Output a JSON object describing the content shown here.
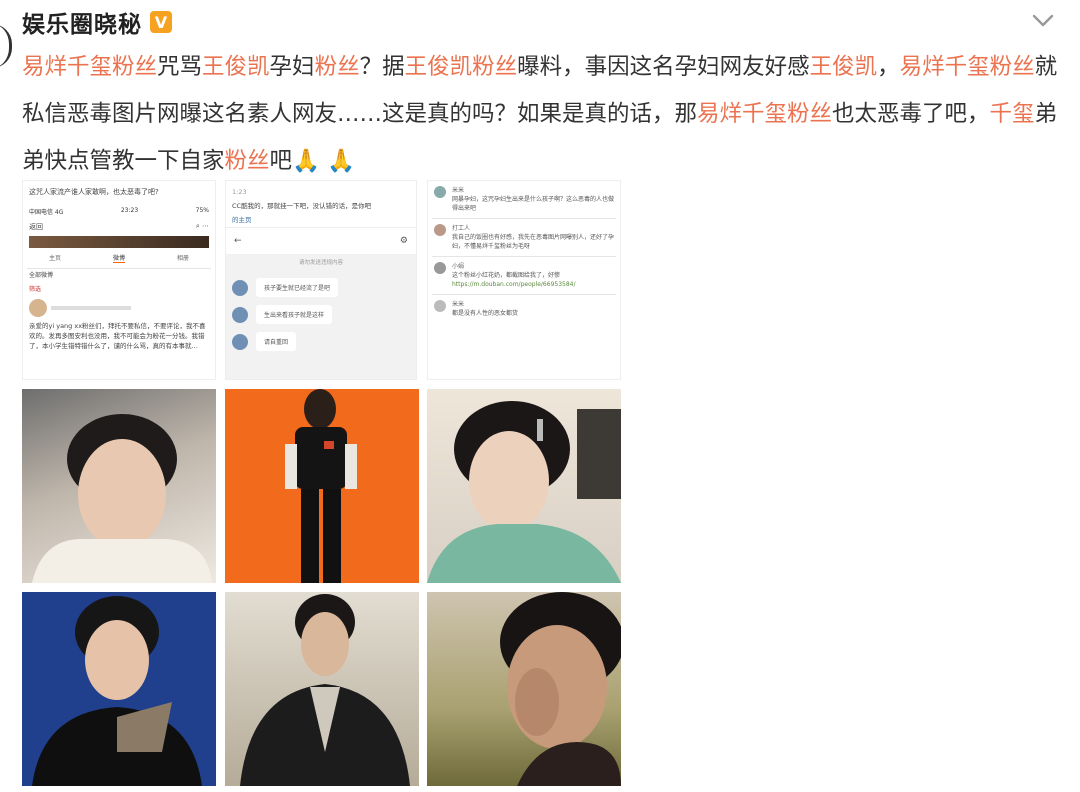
{
  "header": {
    "username": "娱乐圈晓秘",
    "verified_badge": "V",
    "chevron_icon": "chevron-down-icon"
  },
  "post": {
    "segments": [
      {
        "text": "易烊千玺粉丝",
        "hl": true
      },
      {
        "text": "咒骂",
        "hl": false
      },
      {
        "text": "王俊凯",
        "hl": true
      },
      {
        "text": "孕妇",
        "hl": false
      },
      {
        "text": "粉丝",
        "hl": true
      },
      {
        "text": "？据",
        "hl": false
      },
      {
        "text": "王俊凯粉丝",
        "hl": true
      },
      {
        "text": "曝料，事因这名孕妇网友好感",
        "hl": false
      },
      {
        "text": "王俊凯",
        "hl": true
      },
      {
        "text": "，",
        "hl": false
      },
      {
        "text": "易烊千玺粉丝",
        "hl": true
      },
      {
        "text": "就私信恶毒图片网曝这名素人网友……这是真的吗？如果是真的话，那",
        "hl": false
      },
      {
        "text": "易烊千玺粉丝",
        "hl": true
      },
      {
        "text": "也太恶毒了吧，",
        "hl": false
      },
      {
        "text": "千玺",
        "hl": true
      },
      {
        "text": "弟弟快点管教一下自家",
        "hl": false
      },
      {
        "text": "粉丝",
        "hl": true
      },
      {
        "text": "吧🙏 🙏",
        "hl": false
      }
    ],
    "highlight_color": "#eb7350"
  },
  "screenshots": {
    "shot1": {
      "caption": "这咒人家流产谁人家敢啊，也太恶毒了吧?",
      "status_left": "中国电信 4G",
      "status_time": "23:23",
      "status_right": "75%",
      "back": "返回",
      "tabs": [
        "主页",
        "微博",
        "相册"
      ],
      "section": "全部微博",
      "filter": "筛选",
      "body": "亲爱的yi yang xx粉丝们，拜托不要私信，不要评论，我不喜欢的。发再多图安利也没用，我不可能会为粉花一分钱。我错了，本小学生错特错什么了，谴的什么骂，真的有本事就…"
    },
    "shot2": {
      "top_text": "CC酷我的，那就挂一下吧，没认错的话，是你吧",
      "link": "的主页",
      "time": "1:23",
      "notice": "请勿发送违规内容",
      "messages": [
        "孩子要生就已经流了是吧",
        "生出来看孩子就是这样",
        "请自重回"
      ]
    },
    "shot3": {
      "comments": [
        {
          "name": "米米",
          "text": "网暴孕妇，这咒孕妇生出来是什么孩子啊？这么恶毒的人也做得出来吧"
        },
        {
          "name": "打工人",
          "text": "我自己的饭圈也有好感，我先在恶毒图片网曝别人，还好了孕妇，不懂易烊千玺粉丝为毛呀"
        },
        {
          "name": "小娟",
          "text": "这个粉丝小红花奶，都截图给我了，好惨",
          "link": "https://m.douban.com/people/66953584/"
        },
        {
          "name": "米米",
          "text": "都是没有人性的恶女都货"
        }
      ]
    }
  },
  "photos": [
    {
      "icon": "photo-portrait-white-sweater",
      "bg": "#d9cdc0"
    },
    {
      "icon": "photo-orange-backdrop-black-tee",
      "bg": "#f26a1b"
    },
    {
      "icon": "photo-green-sweater-hairclip",
      "bg": "#e9dfd2"
    },
    {
      "icon": "photo-blue-backdrop-black-shirt",
      "bg": "#203f8c"
    },
    {
      "icon": "photo-black-suit-outdoor",
      "bg": "#c9c2b3"
    },
    {
      "icon": "photo-field-hand-on-face",
      "bg": "#a9a170"
    }
  ]
}
